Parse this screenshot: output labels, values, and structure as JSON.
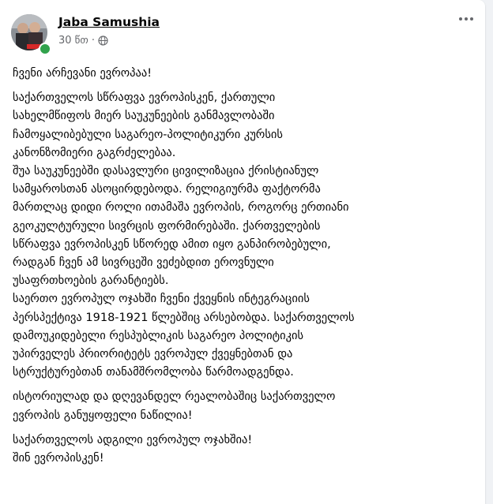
{
  "post": {
    "author": "Jaba Samushia",
    "time": "30 წთ",
    "separator": "·",
    "paragraphs": [
      "ჩვენი არჩევანი ევროპაა!",
      "საქართველოს სწრაფვა ევროპისკენ, ქართული\nსახელმწიფოს მიერ  საუკუნეების განმავლობაში\nჩამოყალიბებული საგარეო-პოლიტიკური კურსის\nკანონზომიერი გაგრძელებაა.\nშუა საუკუნეებში დასავლური ცივილიზაცია ქრისტიანულ\nსამყაროსთან ასოცირდებოდა. რელიგიურმა ფაქტორმა\nმართლაც დიდი როლი ითამაშა ევროპის, როგორც ერთიანი\nგეოკულტურული სივრცის ფორმირებაში. ქართველების\nსწრაფვა ევროპისკენ სწორედ ამით იყო განპირობებული,\nრადგან ჩვენ ამ სივრცეში ვეძებდით ეროვნული\nუსაფრთხოების გარანტიებს.\nსაერთო ევროპულ ოჯახში ჩვენი ქვეყნის ინტეგრაციის\nპერსპექტივა 1918-1921 წლებშიც არსებობდა. საქართველოს\nდამოუკიდებელი რესპუბლიკის საგარეო პოლიტიკის\nუპირველეს პრიორიტეტს ევროპულ ქვეყნებთან და\nსტრუქტურებთან თანამშრომლობა წარმოადგენდა.",
      "ისტორიულად და დღევანდელ რეალობაშიც საქართველო\nევროპის განუყოფელი ნაწილია!",
      "საქართველოს ადგილი ევროპულ ოჯახშია!\nშინ ევროპისკენ!"
    ]
  },
  "icons": {
    "globe": "globe-icon",
    "more": "more-options-icon",
    "online": "online-status-icon"
  },
  "colors": {
    "online": "#31a24c",
    "meta_text": "#65676b",
    "body_text": "#050505",
    "page_bg": "#f0f2f5"
  }
}
